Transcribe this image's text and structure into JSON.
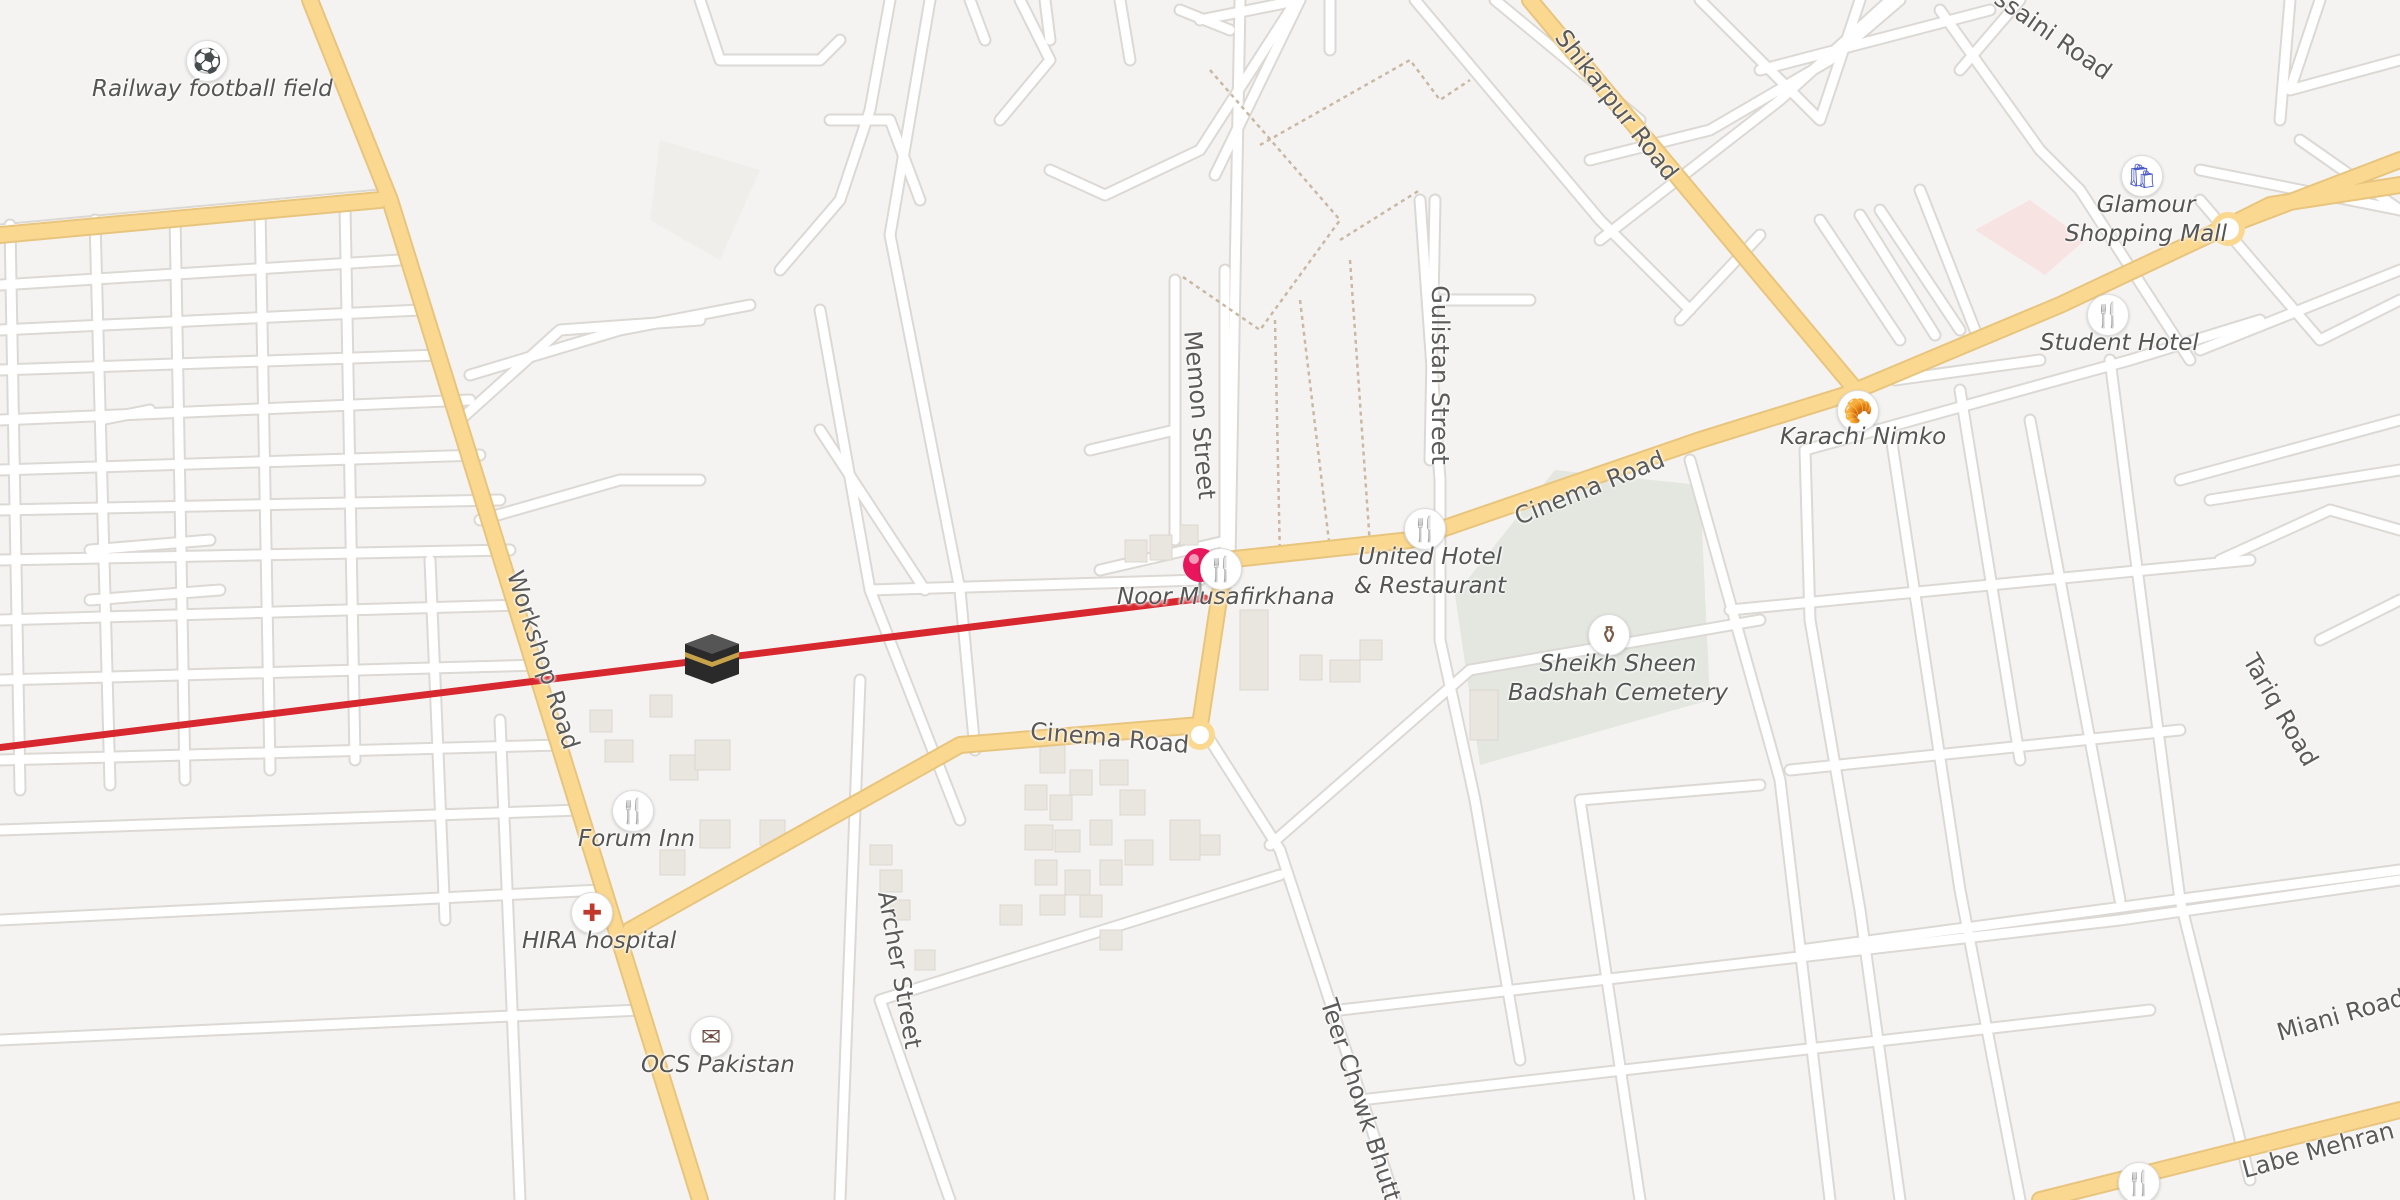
{
  "map": {
    "colors": {
      "background": "#f5f3f1",
      "road_minor": "#ffffff",
      "road_major": "#fbd88f",
      "route_line": "#d7282f",
      "pin": "#e8175d",
      "cemetery": "#e3e7df"
    },
    "roads": [
      {
        "label": "Workshop Road"
      },
      {
        "label": "Cinema Road"
      },
      {
        "label": "Cinema Road"
      },
      {
        "label": "Memon Street"
      },
      {
        "label": "Gulistan Street"
      },
      {
        "label": "Shikarpur Road"
      },
      {
        "label": "Archer Street"
      },
      {
        "label": "Teer Chowk Bhutt"
      },
      {
        "label": "Tariq Road"
      },
      {
        "label": "Miani Road"
      },
      {
        "label": "Labe Mehran"
      },
      {
        "label": "ssaini Road"
      }
    ],
    "places": [
      {
        "label": "Railway football field",
        "icon": "football-icon"
      },
      {
        "label": "Glamour\nShopping Mall",
        "icon": "shopping-bag-icon"
      },
      {
        "label": "Student Hotel",
        "icon": "restaurant-icon"
      },
      {
        "label": "Karachi Nimko",
        "icon": "bakery-icon"
      },
      {
        "label": "United Hotel\n& Restaurant",
        "icon": "restaurant-icon"
      },
      {
        "label": "Noor Musafirkhana",
        "icon": "restaurant-icon"
      },
      {
        "label": "Sheikh Sheen\nBadshah Cemetery",
        "icon": "cemetery-icon"
      },
      {
        "label": "Forum Inn",
        "icon": "restaurant-icon"
      },
      {
        "label": "HIRA hospital",
        "icon": "hospital-icon"
      },
      {
        "label": "OCS Pakistan",
        "icon": "mail-icon"
      },
      {
        "label": "",
        "icon": "restaurant-icon"
      }
    ],
    "markers": {
      "selected_pin": "map-pin-icon",
      "qibla_direction": "kaaba-icon"
    }
  }
}
